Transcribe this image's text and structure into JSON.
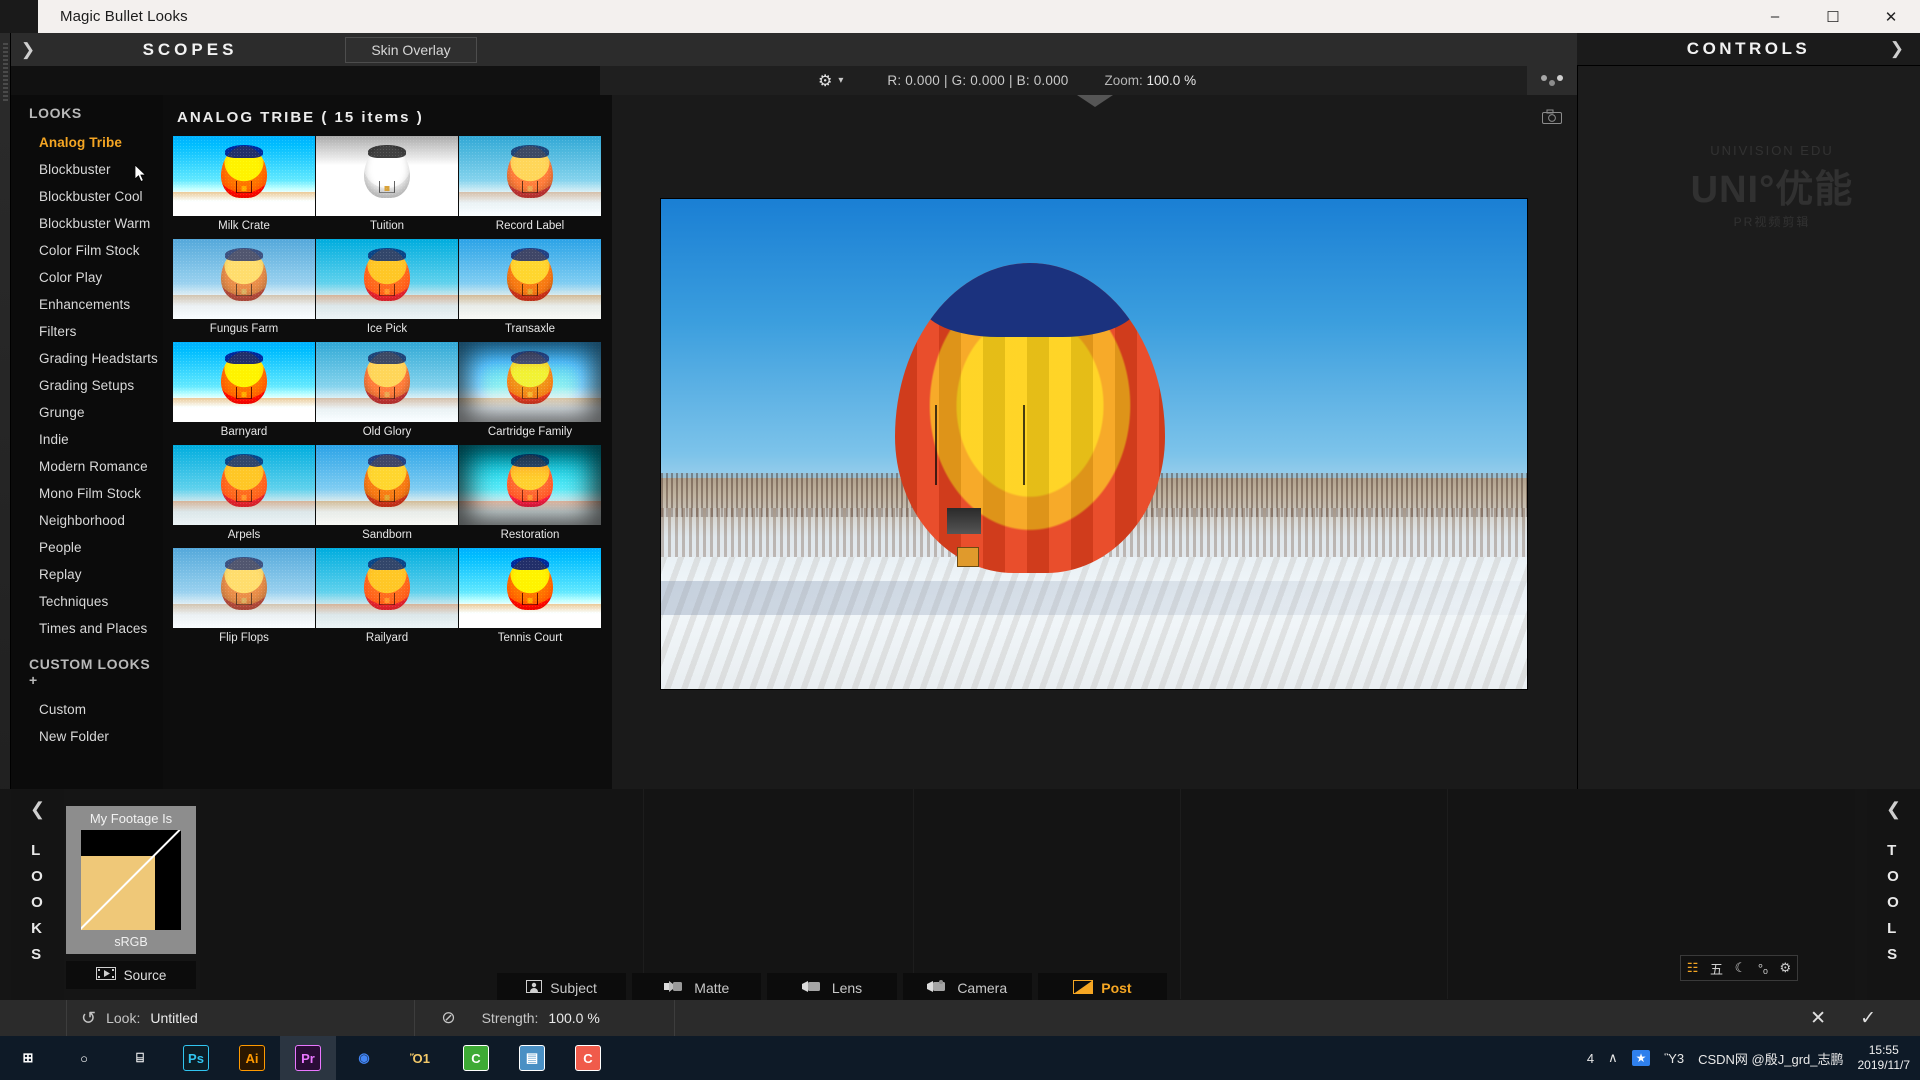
{
  "window": {
    "title": "Magic Bullet Looks",
    "minimize": "–",
    "maximize": "☐",
    "close": "✕"
  },
  "topbar": {
    "collapse_left_icon": "❯",
    "scopes_label": "SCOPES",
    "skin_overlay_label": "Skin Overlay",
    "gear_icon": "⚙",
    "caret_icon": "▾",
    "rgb_readout": "R: 0.000 | G: 0.000 | B: 0.000",
    "zoom_label": "Zoom:",
    "zoom_value": "100.0 %",
    "controls_label": "CONTROLS",
    "controls_chevron": "❯",
    "camera_icon": "□"
  },
  "browser": {
    "looks_header": "LOOKS",
    "looks_items": [
      "Analog Tribe",
      "Blockbuster",
      "Blockbuster Cool",
      "Blockbuster Warm",
      "Color Film Stock",
      "Color Play",
      "Enhancements",
      "Filters",
      "Grading Headstarts",
      "Grading Setups",
      "Grunge",
      "Indie",
      "Modern Romance",
      "Mono Film Stock",
      "Neighborhood",
      "People",
      "Replay",
      "Techniques",
      "Times and Places"
    ],
    "active_item": "Analog Tribe",
    "custom_looks_header": "CUSTOM LOOKS",
    "custom_looks_plus": "+",
    "custom_items": [
      "Custom",
      "New Folder"
    ],
    "grid_title": "ANALOG TRIBE ( 15 items )",
    "presets": [
      {
        "name": "Milk Crate",
        "style": "f-crush"
      },
      {
        "name": "Tuition",
        "style": "f-bw"
      },
      {
        "name": "Record Label",
        "style": "f-cool"
      },
      {
        "name": "Fungus Farm",
        "style": "f-faded"
      },
      {
        "name": "Ice Pick",
        "style": "f-teal"
      },
      {
        "name": "Transaxle",
        "style": "f-warm"
      },
      {
        "name": "Barnyard",
        "style": "f-crush"
      },
      {
        "name": "Old Glory",
        "style": "f-cool"
      },
      {
        "name": "Cartridge Family",
        "style": "f-bloom f-vignette"
      },
      {
        "name": "Arpels",
        "style": "f-teal"
      },
      {
        "name": "Sandborn",
        "style": "f-warm"
      },
      {
        "name": "Restoration",
        "style": "f-pink f-vignette"
      },
      {
        "name": "Flip Flops",
        "style": "f-faded"
      },
      {
        "name": "Railyard",
        "style": "f-teal"
      },
      {
        "name": "Tennis Court",
        "style": "f-crush"
      }
    ]
  },
  "controls_panel": {
    "watermark_top": "UNIVISION EDU",
    "watermark_main": "UNI°优能",
    "watermark_bottom": "PR视频剪辑"
  },
  "bottom": {
    "looks_rail_chevron": "❮",
    "looks_rail_letters": [
      "L",
      "O",
      "O",
      "K",
      "S"
    ],
    "tools_rail_chevron": "❮",
    "tools_rail_letters": [
      "T",
      "O",
      "O",
      "L",
      "S"
    ],
    "footage_card_title": "My Footage Is",
    "footage_card_value": "sRGB",
    "source_button": "Source",
    "source_icon": "film-strip-icon",
    "tabs": [
      {
        "label": "Subject",
        "icon": "person-icon",
        "active": false
      },
      {
        "label": "Matte",
        "icon": "matte-icon",
        "active": false
      },
      {
        "label": "Lens",
        "icon": "lens-icon",
        "active": false
      },
      {
        "label": "Camera",
        "icon": "camera-icon",
        "active": false
      },
      {
        "label": "Post",
        "icon": "post-icon",
        "active": true
      }
    ],
    "mini_toolbar_icons": [
      "☷",
      "五",
      "☾",
      "°ₒ",
      "⚙"
    ]
  },
  "statusbar": {
    "reset_icon": "↺",
    "look_label": "Look:",
    "look_value": "Untitled",
    "strength_icon": "⊘",
    "strength_label": "Strength:",
    "strength_value": "100.0 %",
    "cancel_icon": "✕",
    "confirm_icon": "✓"
  },
  "taskbar": {
    "items": [
      {
        "name": "start",
        "glyph": "⊞",
        "color": "transparent",
        "text": "#ffffff",
        "active": false
      },
      {
        "name": "cortana",
        "glyph": "○",
        "color": "transparent",
        "text": "#ffffff",
        "active": false
      },
      {
        "name": "task-view",
        "glyph": "⌸",
        "color": "transparent",
        "text": "#ffffff",
        "active": false
      },
      {
        "name": "photoshop",
        "glyph": "Ps",
        "color": "#0b1d26",
        "text": "#31c5f0",
        "active": false
      },
      {
        "name": "illustrator",
        "glyph": "Ai",
        "color": "#2b1700",
        "text": "#ff9a00",
        "active": false
      },
      {
        "name": "premiere",
        "glyph": "Pr",
        "color": "#2a0d36",
        "text": "#ea77ff",
        "active": true
      },
      {
        "name": "chrome",
        "glyph": "◉",
        "color": "transparent",
        "text": "#4285f4",
        "active": false
      },
      {
        "name": "file-explorer",
        "glyph": "Ὄ1",
        "color": "transparent",
        "text": "#f3c969",
        "active": false
      },
      {
        "name": "wechat",
        "glyph": "C",
        "color": "#3eaa35",
        "text": "#ffffff",
        "active": false
      },
      {
        "name": "winrar",
        "glyph": "▤",
        "color": "#4a90c4",
        "text": "#ffffff",
        "active": false
      },
      {
        "name": "camtasia",
        "glyph": "C",
        "color": "#f05b4b",
        "text": "#ffffff",
        "active": false
      }
    ],
    "tray": {
      "people_icon": "὆4",
      "chevron_icon": "∧",
      "star_icon": "★",
      "network_icon": "Ὓ3",
      "csdn_text": "CSDN网 @殷J_grd_志鹏",
      "time": "15:55",
      "date": "2019/11/7"
    }
  }
}
